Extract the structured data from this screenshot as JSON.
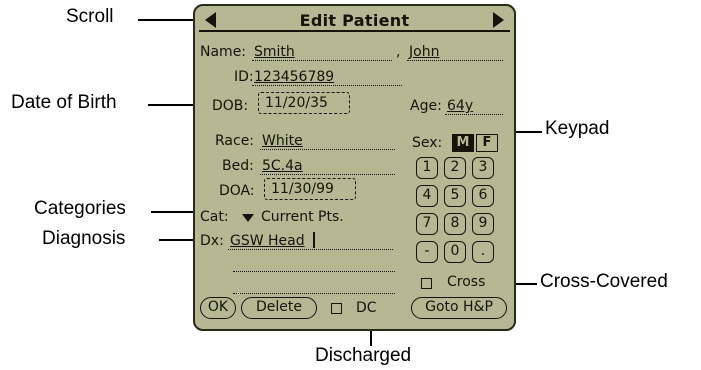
{
  "callouts": {
    "scroll": "Scroll",
    "date_of_birth": "Date of Birth",
    "categories": "Categories",
    "diagnosis": "Diagnosis",
    "keypad": "Keypad",
    "cross_covered": "Cross-Covered",
    "discharged": "Discharged"
  },
  "screen": {
    "title": "Edit Patient",
    "name_label": "Name:",
    "last_name": "Smith",
    "name_separator": ",",
    "first_name": "John",
    "id_label": "ID:",
    "id_value": "123456789",
    "dob_label": "DOB:",
    "dob_value": "11/20/35",
    "age_label": "Age:",
    "age_value": "64y",
    "race_label": "Race:",
    "race_value": "White",
    "sex_label": "Sex:",
    "sex_options": [
      "M",
      "F"
    ],
    "sex_selected": "M",
    "bed_label": "Bed:",
    "bed_value": "5C.4a",
    "doa_label": "DOA:",
    "doa_value": "11/30/99",
    "cat_label": "Cat:",
    "cat_value": "Current Pts.",
    "dx_label": "Dx:",
    "dx_value": "GSW Head",
    "keypad_keys": [
      "1",
      "2",
      "3",
      "4",
      "5",
      "6",
      "7",
      "8",
      "9",
      "-",
      "0",
      "."
    ],
    "cross_label": "Cross",
    "cross_checked": false,
    "dc_label": "DC",
    "dc_checked": false,
    "buttons": {
      "ok": "OK",
      "delete": "Delete",
      "goto_hp": "Goto H&P"
    }
  },
  "colors": {
    "lcd_background": "#b4b993",
    "lcd_ink": "#14140a"
  }
}
